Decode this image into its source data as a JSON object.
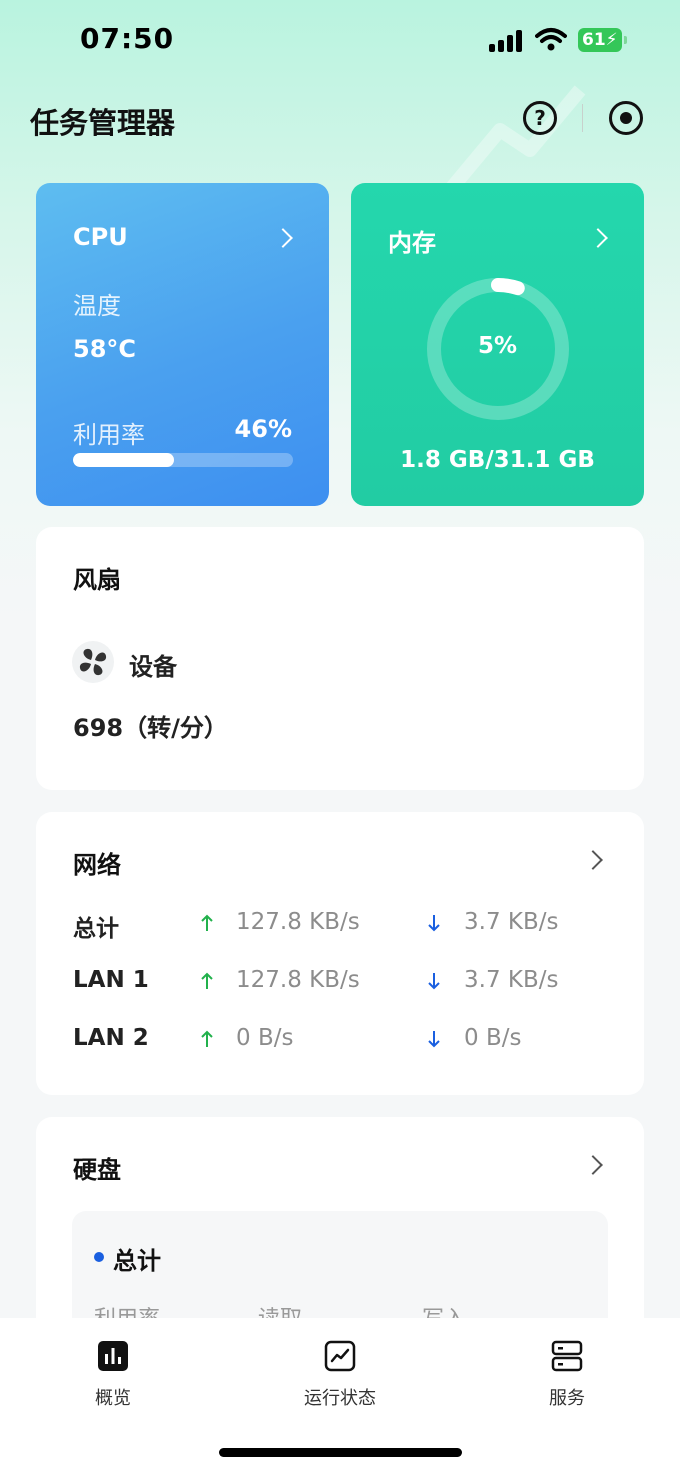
{
  "status_bar": {
    "time": "07:50",
    "battery": "61"
  },
  "header": {
    "title": "任务管理器"
  },
  "cpu": {
    "label": "CPU",
    "temp_label": "温度",
    "temp_value": "58°C",
    "usage_label": "利用率",
    "usage_value": "46%",
    "usage_fraction": 0.46
  },
  "memory": {
    "label": "内存",
    "percent": "5%",
    "percent_fraction": 0.05,
    "size": "1.8 GB/31.1 GB"
  },
  "fan": {
    "title": "风扇",
    "device": "设备",
    "speed": "698（转/分）"
  },
  "network": {
    "title": "网络",
    "rows": [
      {
        "name": "总计",
        "up": "127.8 KB/s",
        "down": "3.7 KB/s"
      },
      {
        "name": "LAN 1",
        "up": "127.8 KB/s",
        "down": "3.7 KB/s"
      },
      {
        "name": "LAN 2",
        "up": "0 B/s",
        "down": "0 B/s"
      }
    ]
  },
  "disk": {
    "title": "硬盘",
    "total_label": "总计",
    "columns": [
      "利用率",
      "读取",
      "写入"
    ]
  },
  "tabs": [
    {
      "label": "概览",
      "icon": "bar-chart-icon"
    },
    {
      "label": "运行状态",
      "icon": "line-chart-icon"
    },
    {
      "label": "服务",
      "icon": "server-icon"
    }
  ],
  "colors": {
    "cpu_card": "#4aa0ef",
    "memory_card": "#22cca3",
    "up_arrow": "#22b14c",
    "down_arrow": "#1a5fe0"
  }
}
